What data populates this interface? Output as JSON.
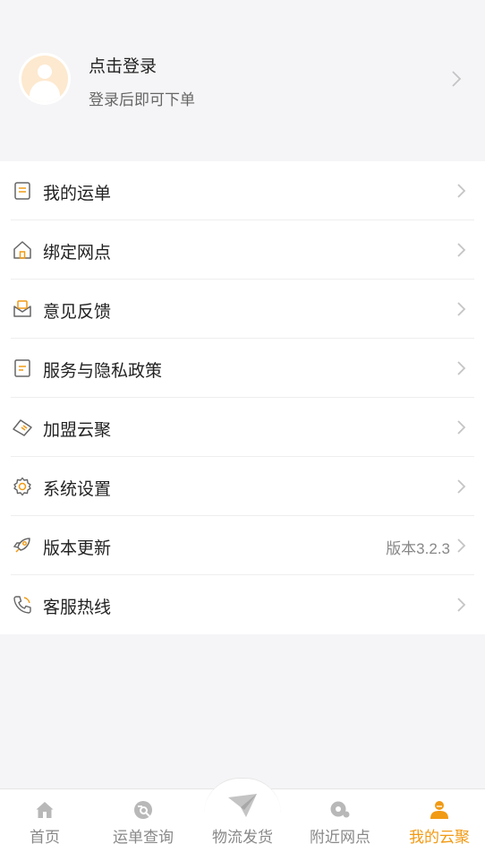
{
  "profile": {
    "title": "点击登录",
    "subtitle": "登录后即可下单"
  },
  "menu": {
    "items": [
      {
        "label": "我的运单",
        "icon": "receipt-icon"
      },
      {
        "label": "绑定网点",
        "icon": "home-icon"
      },
      {
        "label": "意见反馈",
        "icon": "feedback-mail-icon"
      },
      {
        "label": "服务与隐私政策",
        "icon": "document-icon"
      },
      {
        "label": "加盟云聚",
        "icon": "handshake-icon"
      },
      {
        "label": "系统设置",
        "icon": "gear-icon"
      },
      {
        "label": "版本更新",
        "icon": "rocket-icon",
        "value": "版本3.2.3"
      },
      {
        "label": "客服热线",
        "icon": "phone-icon"
      }
    ]
  },
  "tabbar": {
    "tabs": [
      {
        "label": "首页",
        "icon": "home-icon"
      },
      {
        "label": "运单查询",
        "icon": "search-waybill-icon"
      },
      {
        "label": "物流发货",
        "icon": "paper-plane-icon"
      },
      {
        "label": "附近网点",
        "icon": "location-icon"
      },
      {
        "label": "我的云聚",
        "icon": "user-icon",
        "active": true
      }
    ]
  },
  "colors": {
    "accent": "#f19a14",
    "background": "#f5f5f7",
    "icon_gray": "#666666",
    "inactive_tab": "#b8b8b8"
  }
}
